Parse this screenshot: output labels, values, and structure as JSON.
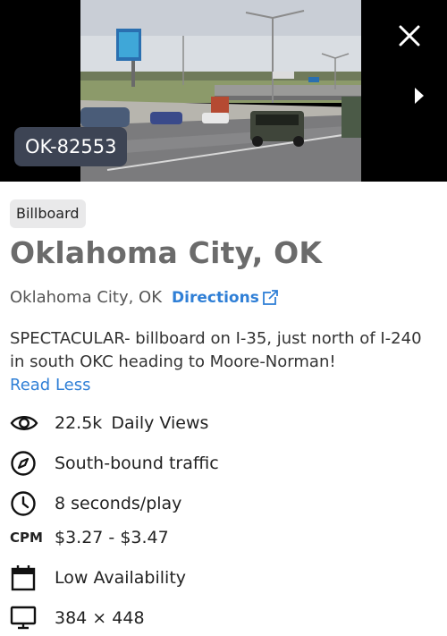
{
  "listing": {
    "id": "OK-82553",
    "type": "Billboard",
    "title": "Oklahoma City, OK",
    "location": "Oklahoma City, OK",
    "directions_label": "Directions",
    "description": "SPECTACULAR- billboard on I-35, just north of I-240 in south OKC heading to Moore-Norman!",
    "read_less_label": "Read Less"
  },
  "stats": {
    "daily_views_value": "22.5k",
    "daily_views_label": "Daily Views",
    "traffic": "South-bound traffic",
    "play_duration": "8 seconds/play",
    "cpm_label": "CPM",
    "cpm_range": "$3.27 - $3.47",
    "availability": "Low Availability",
    "dimensions": "384 × 448"
  },
  "colors": {
    "accent": "#2f7fd6",
    "badge_bg": "#3d4454",
    "type_badge_bg": "#e9e9ea",
    "title": "#6b6b6b"
  },
  "icons": [
    "close-icon",
    "chevron-right-icon",
    "external-link-icon",
    "eye-icon",
    "compass-icon",
    "clock-icon",
    "calendar-icon",
    "monitor-icon"
  ]
}
